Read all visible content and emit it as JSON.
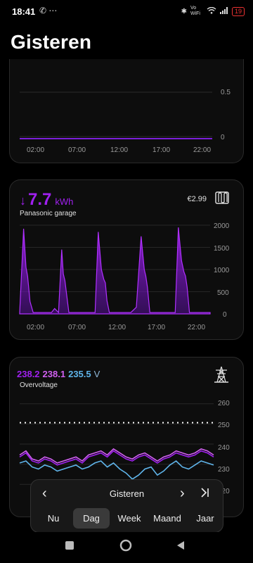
{
  "status_bar": {
    "time": "18:41",
    "network_label": "Vo WiFi",
    "battery": "19"
  },
  "page": {
    "title": "Gisteren"
  },
  "card1": {
    "x_ticks": [
      "02:00",
      "07:00",
      "12:00",
      "17:00",
      "22:00"
    ],
    "y_ticks": [
      "0.5",
      "0"
    ]
  },
  "card2": {
    "value": "7.7",
    "unit": "kWh",
    "label": "Panasonic garage",
    "cost": "€2.99",
    "icon": "heatpump-icon",
    "x_ticks": [
      "02:00",
      "07:00",
      "12:00",
      "17:00",
      "22:00"
    ],
    "y_ticks": [
      "2000",
      "1500",
      "1000",
      "500",
      "0"
    ],
    "color": "#a020f0"
  },
  "card3": {
    "v1": "238.2",
    "v2": "238.1",
    "v3": "235.5",
    "unit": "V",
    "label": "Overvoltage",
    "icon": "power-pylon-icon",
    "y_ticks": [
      "260",
      "250",
      "240",
      "230",
      "220"
    ],
    "colors": [
      "#a020f0",
      "#d060f0",
      "#5fb4ea"
    ]
  },
  "range_selector": {
    "title": "Gisteren",
    "tabs": [
      "Nu",
      "Dag",
      "Week",
      "Maand",
      "Jaar"
    ],
    "active_tab": "Dag"
  },
  "chart_data": [
    {
      "type": "line",
      "x_labels": [
        "02:00",
        "07:00",
        "12:00",
        "17:00",
        "22:00"
      ],
      "ylim": [
        0,
        0.5
      ],
      "series": [
        {
          "values": [
            0,
            0,
            0,
            0,
            0
          ]
        }
      ]
    },
    {
      "type": "area",
      "x_labels": [
        "02:00",
        "07:00",
        "12:00",
        "17:00",
        "22:00"
      ],
      "ylim": [
        0,
        2000
      ],
      "series": [
        {
          "x": [
            0,
            0.5,
            0.8,
            1.0,
            1.3,
            1.7,
            3,
            4,
            4.4,
            4.9,
            5.3,
            5.5,
            5.7,
            6.2,
            8,
            9.5,
            9.9,
            10.3,
            10.6,
            10.8,
            11.0,
            11.3,
            12,
            14,
            14.7,
            15.3,
            15.7,
            15.9,
            16.1,
            16.4,
            18,
            19.6,
            20.0,
            20.4,
            20.7,
            20.9,
            21.1,
            21.4,
            22,
            24
          ],
          "y": [
            30,
            1920,
            1050,
            850,
            280,
            30,
            30,
            30,
            120,
            30,
            1450,
            900,
            750,
            30,
            30,
            30,
            1850,
            1000,
            780,
            700,
            300,
            30,
            30,
            30,
            150,
            1750,
            1000,
            850,
            600,
            30,
            30,
            30,
            1950,
            1200,
            950,
            850,
            600,
            30,
            30,
            30
          ]
        }
      ]
    },
    {
      "type": "line",
      "ylim": [
        218,
        262
      ],
      "reference_line": 252,
      "series": [
        {
          "values": [
            235,
            237,
            233,
            232,
            234,
            233,
            231,
            232,
            233,
            234,
            232,
            235,
            236,
            237,
            235,
            238,
            236,
            234,
            233,
            235,
            236,
            234,
            232,
            234,
            235,
            237,
            236,
            235,
            236,
            238,
            237,
            235
          ]
        },
        {
          "values": [
            236,
            238,
            234,
            233,
            235,
            234,
            232,
            233,
            234,
            235,
            233,
            236,
            237,
            238,
            236,
            239,
            237,
            235,
            234,
            236,
            237,
            235,
            233,
            235,
            236,
            238,
            237,
            236,
            237,
            239,
            238,
            236
          ]
        },
        {
          "values": [
            232,
            233,
            230,
            229,
            231,
            230,
            228,
            229,
            230,
            231,
            229,
            230,
            232,
            233,
            230,
            232,
            229,
            227,
            224,
            226,
            229,
            230,
            226,
            228,
            231,
            233,
            230,
            229,
            231,
            233,
            232,
            231
          ]
        }
      ]
    }
  ]
}
